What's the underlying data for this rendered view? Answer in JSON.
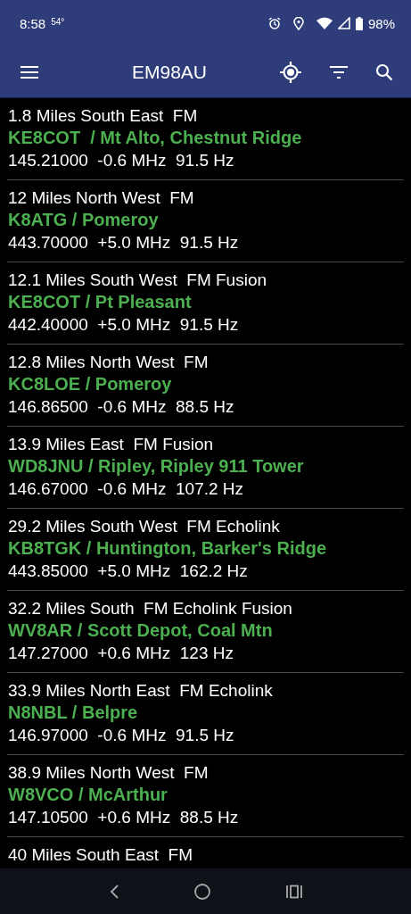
{
  "status_bar": {
    "time": "8:58",
    "temperature": "54°",
    "battery": "98%"
  },
  "app_bar": {
    "title": "EM98AU"
  },
  "repeaters": [
    {
      "distance": "1.8 Miles South East  FM",
      "name": "KE8COT  / Mt Alto, Chestnut Ridge",
      "details": "145.21000  -0.6 MHz  91.5 Hz"
    },
    {
      "distance": "12 Miles North West  FM",
      "name": "K8ATG / Pomeroy",
      "details": "443.70000  +5.0 MHz  91.5 Hz"
    },
    {
      "distance": "12.1 Miles South West  FM Fusion",
      "name": "KE8COT / Pt Pleasant",
      "details": "442.40000  +5.0 MHz  91.5 Hz"
    },
    {
      "distance": "12.8 Miles North West  FM",
      "name": "KC8LOE / Pomeroy",
      "details": "146.86500  -0.6 MHz  88.5 Hz"
    },
    {
      "distance": "13.9 Miles East  FM Fusion",
      "name": "WD8JNU / Ripley, Ripley 911 Tower",
      "details": "146.67000  -0.6 MHz  107.2 Hz"
    },
    {
      "distance": "29.2 Miles South West  FM Echolink",
      "name": "KB8TGK / Huntington, Barker's Ridge",
      "details": "443.85000  +5.0 MHz  162.2 Hz"
    },
    {
      "distance": "32.2 Miles South  FM Echolink Fusion",
      "name": "WV8AR / Scott Depot, Coal Mtn",
      "details": "147.27000  +0.6 MHz  123 Hz"
    },
    {
      "distance": "33.9 Miles North East  FM Echolink",
      "name": "N8NBL / Belpre",
      "details": "146.97000  -0.6 MHz  91.5 Hz"
    },
    {
      "distance": "38.9 Miles North West  FM",
      "name": "W8VCO / McArthur",
      "details": "147.10500  +0.6 MHz  88.5 Hz"
    },
    {
      "distance": "40 Miles South East  FM"
    }
  ]
}
